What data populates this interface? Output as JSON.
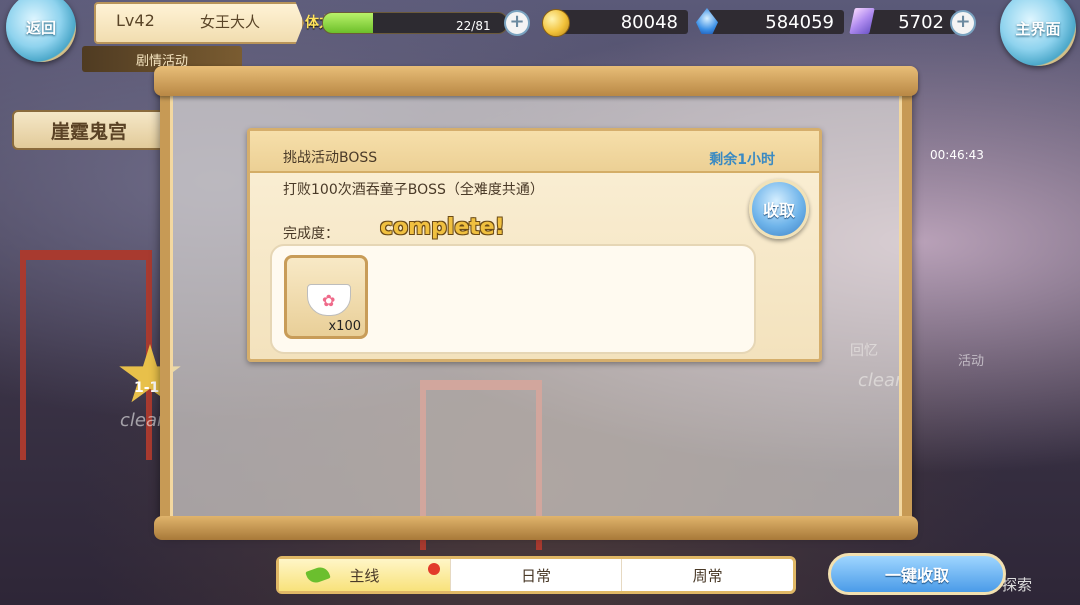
{
  "topbar": {
    "back_label": "返回",
    "level": "Lv42",
    "player_name": "女王大人",
    "section_label": "剧情活动",
    "stamina_label": "体力",
    "stamina_text": "22/81",
    "stamina_fraction": 0.27,
    "gold": "80048",
    "blue_currency": "584059",
    "crystal": "5702",
    "home_label": "主界面"
  },
  "map": {
    "location_name": "崖霆鬼宫",
    "stage_label": "1-1",
    "clear_label": "clear",
    "memory_label": "回忆",
    "activity_label": "活动",
    "timer": "00:46:43",
    "explore_label": "探索"
  },
  "task": {
    "title": "挑战活动BOSS",
    "time_left": "剩余1小时",
    "description": "打败100次酒吞童子BOSS（全难度共通）",
    "progress_label": "完成度：",
    "progress_status": "complete!",
    "claim_label": "收取",
    "reward_qty": "x100"
  },
  "tabs": [
    {
      "label": "主线"
    },
    {
      "label": "日常"
    },
    {
      "label": "周常"
    }
  ],
  "collect_all_label": "一键收取"
}
